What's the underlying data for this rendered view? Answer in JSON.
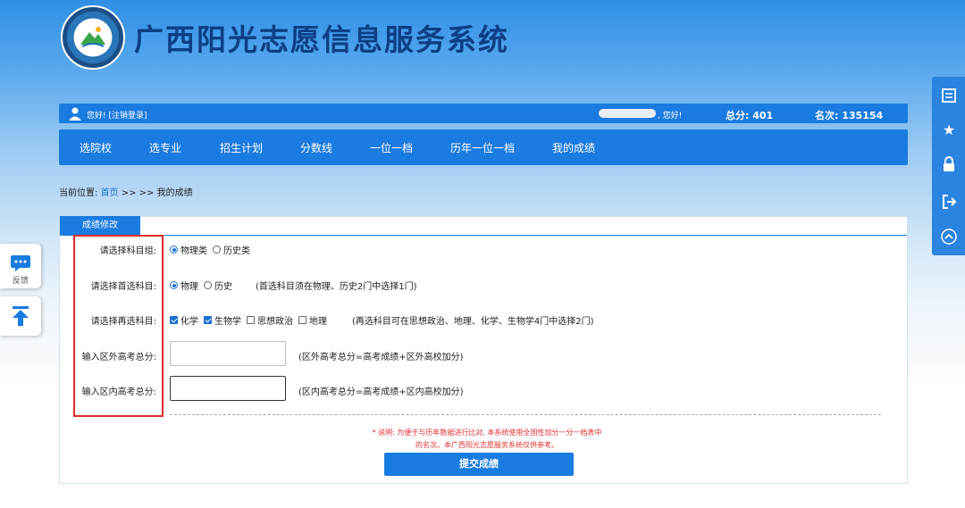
{
  "header": {
    "title": "广西阳光志愿信息服务系统"
  },
  "userbar": {
    "greeting": "您好! [注销登录]",
    "hello": ", 您好!",
    "score": "总分: 401",
    "rank": "名次: 135154"
  },
  "nav": {
    "items": [
      "选院校",
      "选专业",
      "招生计划",
      "分数线",
      "一位一档",
      "历年一位一档",
      "我的成绩"
    ]
  },
  "breadcrumb": {
    "prefix": "当前位置: ",
    "home": "首页",
    "suffix": " >> >> 我的成绩"
  },
  "panel": {
    "tab": "成绩修改"
  },
  "form": {
    "group_label": "请选择科目组:",
    "group_opt1": "物理类",
    "group_opt2": "历史类",
    "first_label": "请选择首选科目:",
    "first_opt1": "物理",
    "first_opt2": "历史",
    "first_note": "(首选科目须在物理、历史2门中选择1门)",
    "second_label": "请选择再选科目:",
    "second_opt1": "化学",
    "second_opt2": "生物学",
    "second_opt3": "思想政治",
    "second_opt4": "地理",
    "second_note": "(再选科目可在思想政治、地理、化学、生物学4门中选择2门)",
    "outside_label": "输入区外高考总分:",
    "outside_value": "",
    "outside_note": "(区外高考总分=高考成绩+区外高校加分)",
    "inside_label": "输入区内高考总分:",
    "inside_value": "",
    "inside_note": "(区内高考总分=高考成绩+区内高校加分)",
    "explain_line1": "* 说明: 为便于与历年数据进行比对, 本系统使用全国性加分一分一档表中",
    "explain_line2": "的名次。本广西阳光志愿服务系统仅供参考。",
    "submit": "提交成绩"
  },
  "float_left": {
    "feedback": "反馈"
  },
  "colors": {
    "primary": "#1a7be0",
    "title": "#0d3f86",
    "highlight": "#e02a2a"
  }
}
